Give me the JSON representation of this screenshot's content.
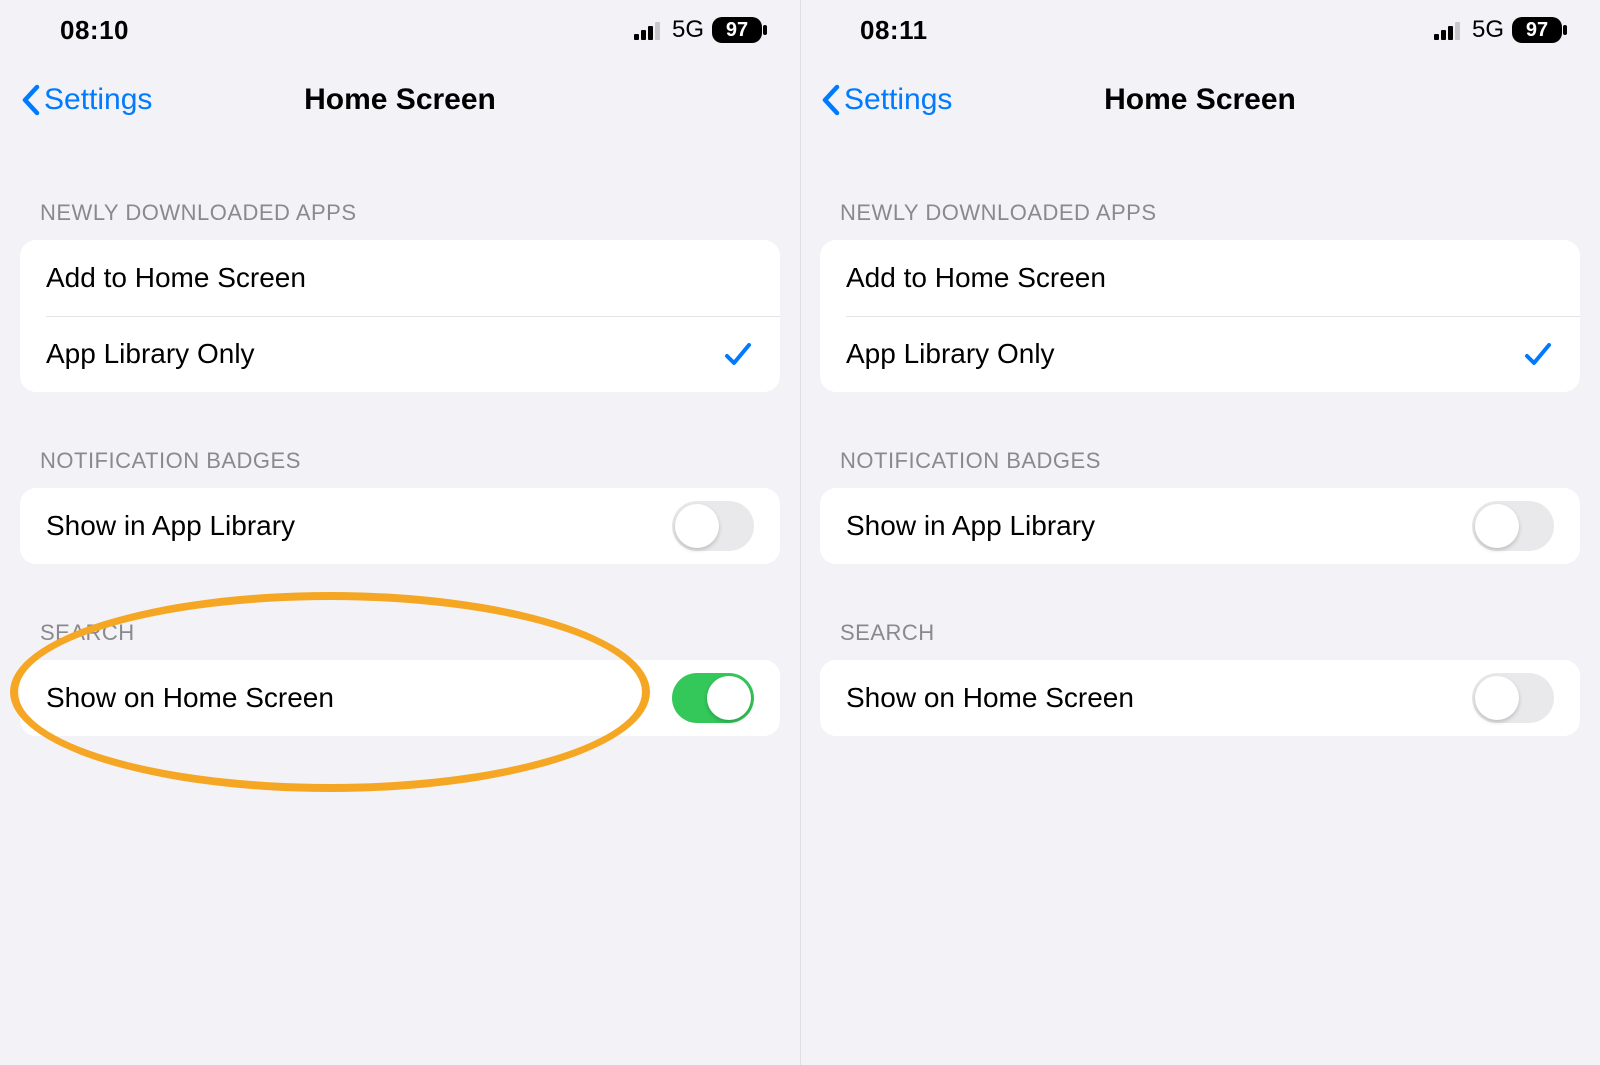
{
  "colors": {
    "accent_blue": "#007aff",
    "toggle_green": "#34c759",
    "highlight_orange": "#f5a623",
    "background": "#f2f2f7",
    "cell_background": "#ffffff",
    "section_header_text": "#8a8a8e"
  },
  "screens": [
    {
      "status": {
        "time": "08:10",
        "network": "5G",
        "battery": "97"
      },
      "nav": {
        "back_label": "Settings",
        "title": "Home Screen"
      },
      "sections": {
        "newly_downloaded": {
          "header": "NEWLY DOWNLOADED APPS",
          "options": [
            {
              "label": "Add to Home Screen",
              "selected": false
            },
            {
              "label": "App Library Only",
              "selected": true
            }
          ]
        },
        "notification_badges": {
          "header": "NOTIFICATION BADGES",
          "row": {
            "label": "Show in App Library",
            "toggle_on": false
          }
        },
        "search": {
          "header": "SEARCH",
          "row": {
            "label": "Show on Home Screen",
            "toggle_on": true
          }
        }
      },
      "highlight_search_row": true
    },
    {
      "status": {
        "time": "08:11",
        "network": "5G",
        "battery": "97"
      },
      "nav": {
        "back_label": "Settings",
        "title": "Home Screen"
      },
      "sections": {
        "newly_downloaded": {
          "header": "NEWLY DOWNLOADED APPS",
          "options": [
            {
              "label": "Add to Home Screen",
              "selected": false
            },
            {
              "label": "App Library Only",
              "selected": true
            }
          ]
        },
        "notification_badges": {
          "header": "NOTIFICATION BADGES",
          "row": {
            "label": "Show in App Library",
            "toggle_on": false
          }
        },
        "search": {
          "header": "SEARCH",
          "row": {
            "label": "Show on Home Screen",
            "toggle_on": false
          }
        }
      },
      "highlight_search_row": false
    }
  ]
}
